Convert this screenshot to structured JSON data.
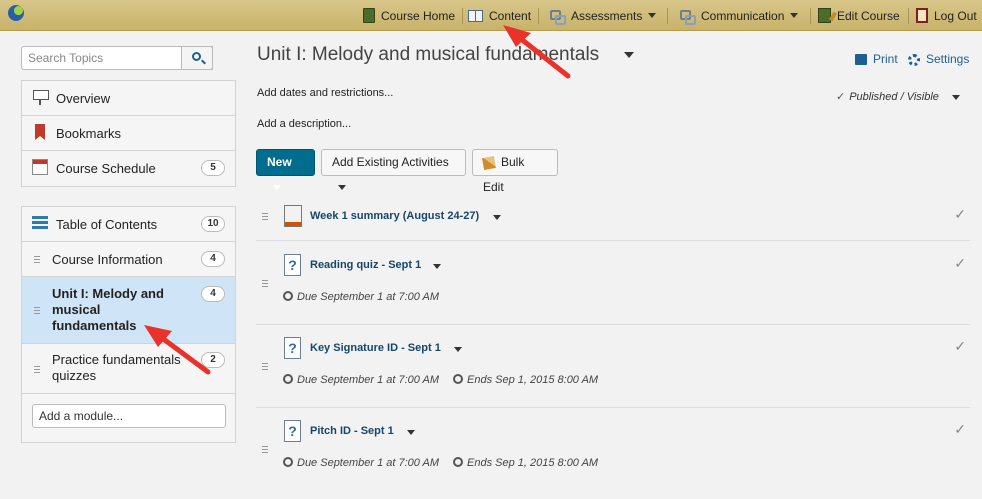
{
  "topbar": {
    "nav": [
      {
        "label": "Course Home",
        "icon": "book-icon"
      },
      {
        "label": "Content",
        "icon": "open-book-icon"
      },
      {
        "label": "Assessments",
        "icon": "link-icon",
        "dropdown": true
      },
      {
        "label": "Communication",
        "icon": "link-icon",
        "dropdown": true
      },
      {
        "label": "Edit Course",
        "icon": "edit-icon"
      },
      {
        "label": "Log Out",
        "icon": "logout-icon"
      }
    ]
  },
  "sidebar": {
    "search_placeholder": "Search Topics",
    "top_items": [
      {
        "label": "Overview"
      },
      {
        "label": "Bookmarks"
      },
      {
        "label": "Course Schedule",
        "badge": "5"
      }
    ],
    "toc": {
      "label": "Table of Contents",
      "badge": "10"
    },
    "modules": [
      {
        "label": "Course Information",
        "badge": "4"
      },
      {
        "label": "Unit I: Melody and musical fundamentals",
        "badge": "4",
        "selected": true
      },
      {
        "label": "Practice fundamentals quizzes",
        "badge": "2"
      }
    ],
    "add_module_placeholder": "Add a module..."
  },
  "main": {
    "title": "Unit I: Melody and musical fundamentals",
    "print_label": "Print",
    "settings_label": "Settings",
    "add_dates": "Add dates and restrictions...",
    "add_description": "Add a description...",
    "status": "Published / Visible",
    "new_button": "New",
    "add_existing_button": "Add Existing Activities",
    "bulk_edit_button": "Bulk Edit",
    "items": [
      {
        "title": "Week 1 summary (August 24-27)",
        "type": "link"
      },
      {
        "title": "Reading quiz - Sept 1",
        "type": "quiz",
        "due": "Due September 1 at 7:00 AM"
      },
      {
        "title": "Key Signature ID - Sept 1",
        "type": "quiz",
        "due": "Due September 1 at 7:00 AM",
        "ends": "Ends Sep 1, 2015 8:00 AM"
      },
      {
        "title": "Pitch ID - Sept 1",
        "type": "quiz",
        "due": "Due September 1 at 7:00 AM",
        "ends": "Ends Sep 1, 2015 8:00 AM"
      }
    ]
  },
  "colors": {
    "topbar": "#cdb774",
    "primary": "#006d8f",
    "link": "#16466b",
    "selected": "#d0e4f7",
    "annotation_arrow": "#e8322a"
  }
}
